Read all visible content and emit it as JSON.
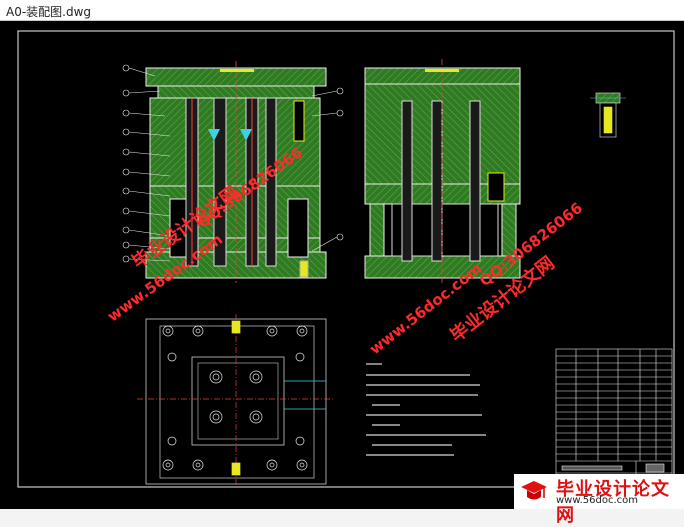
{
  "window": {
    "title": "A0-装配图.dwg"
  },
  "watermarks": {
    "url": "www.56doc.com",
    "qq": "QQ:306826066",
    "site_cn": "毕业设计论文网"
  },
  "logo": {
    "cn": "毕业设计论文网",
    "url": "www.56doc.com"
  },
  "colors": {
    "background": "#000000",
    "hatch": "#3a8f2a",
    "outline": "#e8e8e8",
    "watermark": "#ff2a2a",
    "accent_yellow": "#e8e820",
    "accent_cyan": "#40d0e0",
    "accent_red": "#ff3030"
  }
}
